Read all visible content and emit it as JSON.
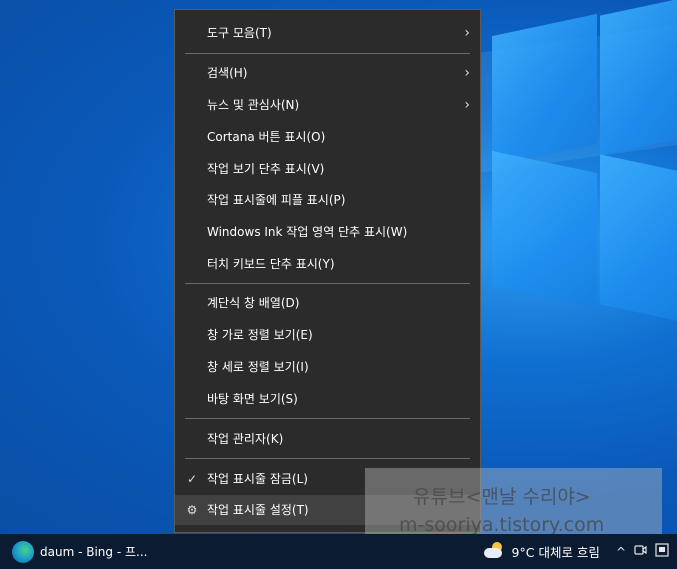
{
  "menu": {
    "toolbars": "도구 모음(T)",
    "search": "검색(H)",
    "news": "뉴스 및 관심사(N)",
    "cortana": "Cortana 버튼 표시(O)",
    "task_view": "작업 보기 단추 표시(V)",
    "people": "작업 표시줄에 피플 표시(P)",
    "ink": "Windows Ink 작업 영역 단추 표시(W)",
    "touch_kb": "터치 키보드 단추 표시(Y)",
    "cascade": "계단식 창 배열(D)",
    "stack": "창 가로 정렬 보기(E)",
    "side_by_side": "창 세로 정렬 보기(I)",
    "show_desktop": "바탕 화면 보기(S)",
    "task_manager": "작업 관리자(K)",
    "lock": "작업 표시줄 잠금(L)",
    "settings": "작업 표시줄 설정(T)",
    "submenu_glyph": "›",
    "check_glyph": "✓",
    "gear_glyph": "⚙"
  },
  "watermark": {
    "line1": "유튜브<맨날 수리야>",
    "line2": "m-sooriya.tistory.com"
  },
  "taskbar": {
    "app_label": "daum - Bing - 프...",
    "weather": "9°C 대체로 흐림",
    "chevron_up": "^"
  }
}
